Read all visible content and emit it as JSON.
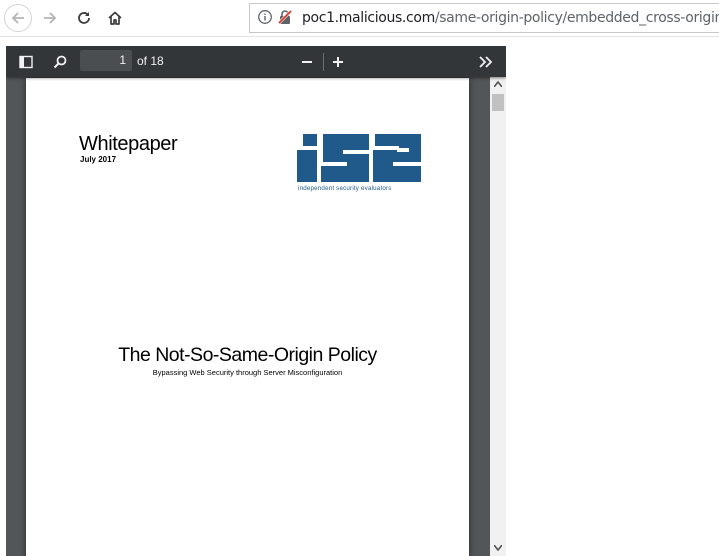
{
  "browser": {
    "url_host": "poc1.malicious.com",
    "url_path": "/same-origin-policy/embedded_cross-origin.php",
    "icons": [
      "back-arrow-icon",
      "forward-arrow-icon",
      "reload-icon",
      "home-icon",
      "info-icon",
      "insecure-lock-icon"
    ]
  },
  "pdf_toolbar": {
    "current_page": "1",
    "page_total_label": "of 18",
    "icons": [
      "sidebar-toggle-icon",
      "search-icon",
      "minus-icon",
      "plus-icon",
      "double-chevron-right-icon"
    ]
  },
  "document": {
    "doc_type": "Whitepaper",
    "date": "July 2017",
    "logo": {
      "lettering": "ise",
      "tagline": "independent security evaluators",
      "color": "#1f5a8a"
    },
    "title": "The Not-So-Same-Origin Policy",
    "subtitle": "Bypassing Web Security through Server Misconfiguration"
  },
  "colors": {
    "pdf_toolbar_bg": "#323639",
    "pdf_background": "#525659",
    "insecure_red": "#d93025"
  }
}
